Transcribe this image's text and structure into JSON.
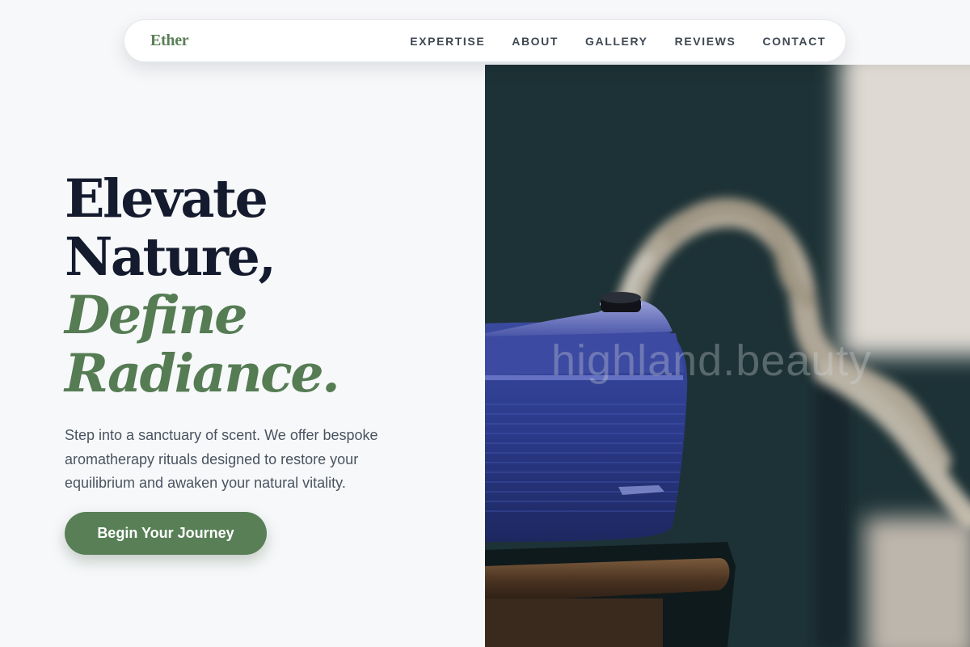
{
  "nav": {
    "brand": "Ether",
    "links": [
      "EXPERTISE",
      "ABOUT",
      "GALLERY",
      "REVIEWS",
      "CONTACT"
    ]
  },
  "hero": {
    "headline_lines": [
      "Elevate",
      "Nature,",
      "Define",
      "Radiance."
    ],
    "description": "Step into a sanctuary of scent. We offer bespoke aromatherapy rituals designed to restore your equilibrium and awaken your natural vitality.",
    "cta_label": "Begin Your Journey"
  },
  "image": {
    "watermark": "highland.beauty"
  },
  "colors": {
    "accent_green": "#557c53",
    "headline_dark": "#141b2e",
    "page_background": "#f7f8fa",
    "diffuser_blue": "#2c3d8c"
  }
}
